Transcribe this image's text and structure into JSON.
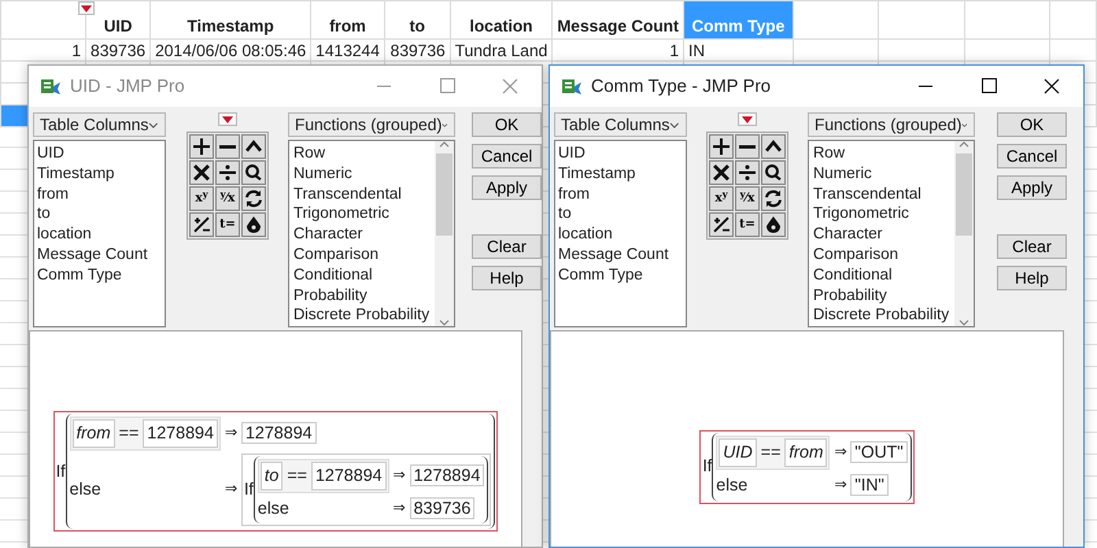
{
  "table": {
    "columns": [
      {
        "label": "UID",
        "kind": "numeric",
        "selected": false
      },
      {
        "label": "Timestamp",
        "kind": "numeric",
        "selected": false
      },
      {
        "label": "from",
        "kind": "numeric",
        "selected": false
      },
      {
        "label": "to",
        "kind": "numeric",
        "selected": false
      },
      {
        "label": "location",
        "kind": "character",
        "selected": false
      },
      {
        "label": "Message Count",
        "kind": "numeric",
        "selected": false
      },
      {
        "label": "Comm Type",
        "kind": "character",
        "selected": true
      }
    ],
    "rows": [
      {
        "number": "1",
        "cells": [
          "839736",
          "2014/06/06 08:05:46",
          "1413244",
          "839736",
          "Tundra Land",
          "1",
          "IN"
        ],
        "selected": false
      },
      {
        "selected": false
      },
      {
        "selected": false
      },
      {
        "selected": true
      }
    ]
  },
  "windows": [
    {
      "title": "UID - JMP Pro",
      "active": false,
      "columns_label": "Table Columns",
      "columns": [
        "UID",
        "Timestamp",
        "from",
        "to",
        "location",
        "Message Count",
        "Comm Type"
      ],
      "functions_label": "Functions (grouped)",
      "functions": [
        "Row",
        "Numeric",
        "Transcendental",
        "Trigonometric",
        "Character",
        "Comparison",
        "Conditional",
        "Probability",
        "Discrete Probability"
      ],
      "keypad_text": [
        "x$^{y}$",
        "$^{y}$⁄x",
        "t="
      ],
      "buttons": [
        "OK",
        "Cancel",
        "Apply",
        "Clear",
        "Help"
      ],
      "formula": {
        "kind": "if",
        "keyword": "If",
        "selected": true,
        "clauses": [
          {
            "condition": [
              {
                "kind": "column",
                "text": "from"
              },
              {
                "kind": "operator",
                "text": "=="
              },
              {
                "kind": "value",
                "text": "1278894"
              }
            ],
            "arrow": "⇒",
            "result": {
              "kind": "value",
              "text": "1278894"
            }
          }
        ],
        "otherwise": {
          "label": "else",
          "arrow": "⇒",
          "result": {
            "kind": "if",
            "keyword": "If",
            "selected": false,
            "clauses": [
              {
                "condition": [
                  {
                    "kind": "column",
                    "text": "to"
                  },
                  {
                    "kind": "operator",
                    "text": "=="
                  },
                  {
                    "kind": "value",
                    "text": "1278894"
                  }
                ],
                "arrow": "⇒",
                "result": {
                  "kind": "value",
                  "text": "1278894"
                }
              }
            ],
            "otherwise": {
              "label": "else",
              "arrow": "⇒",
              "result": {
                "kind": "value",
                "text": "839736"
              }
            }
          }
        }
      }
    },
    {
      "title": "Comm Type - JMP Pro",
      "active": true,
      "columns_label": "Table Columns",
      "columns": [
        "UID",
        "Timestamp",
        "from",
        "to",
        "location",
        "Message Count",
        "Comm Type"
      ],
      "functions_label": "Functions (grouped)",
      "functions": [
        "Row",
        "Numeric",
        "Transcendental",
        "Trigonometric",
        "Character",
        "Comparison",
        "Conditional",
        "Probability",
        "Discrete Probability"
      ],
      "keypad_text": [
        "x$^{y}$",
        "$^{y}$⁄x",
        "t="
      ],
      "buttons": [
        "OK",
        "Cancel",
        "Apply",
        "Clear",
        "Help"
      ],
      "formula": {
        "kind": "if",
        "keyword": "If",
        "selected": true,
        "clauses": [
          {
            "condition": [
              {
                "kind": "column",
                "text": "UID"
              },
              {
                "kind": "operator",
                "text": "=="
              },
              {
                "kind": "column",
                "text": "from"
              }
            ],
            "arrow": "⇒",
            "result": {
              "kind": "value",
              "text": "\"OUT\""
            }
          }
        ],
        "otherwise": {
          "label": "else",
          "arrow": "⇒",
          "result": {
            "kind": "value",
            "text": "\"IN\""
          }
        }
      }
    }
  ]
}
